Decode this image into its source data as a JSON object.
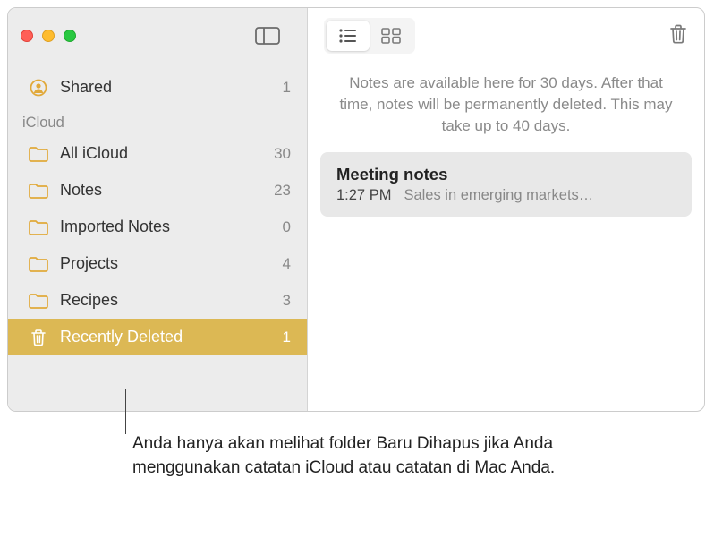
{
  "sidebar": {
    "shared": {
      "label": "Shared",
      "count": "1"
    },
    "section": "iCloud",
    "items": [
      {
        "label": "All iCloud",
        "count": "30"
      },
      {
        "label": "Notes",
        "count": "23"
      },
      {
        "label": "Imported Notes",
        "count": "0"
      },
      {
        "label": "Projects",
        "count": "4"
      },
      {
        "label": "Recipes",
        "count": "3"
      }
    ],
    "recentlyDeleted": {
      "label": "Recently Deleted",
      "count": "1"
    }
  },
  "content": {
    "info": "Notes are available here for 30 days. After that time, notes will be permanently deleted. This may take up to 40 days.",
    "note": {
      "title": "Meeting notes",
      "time": "1:27 PM",
      "preview": "Sales in emerging markets…"
    }
  },
  "callout": "Anda hanya akan melihat folder Baru Dihapus jika Anda menggunakan catatan iCloud atau catatan di Mac Anda."
}
